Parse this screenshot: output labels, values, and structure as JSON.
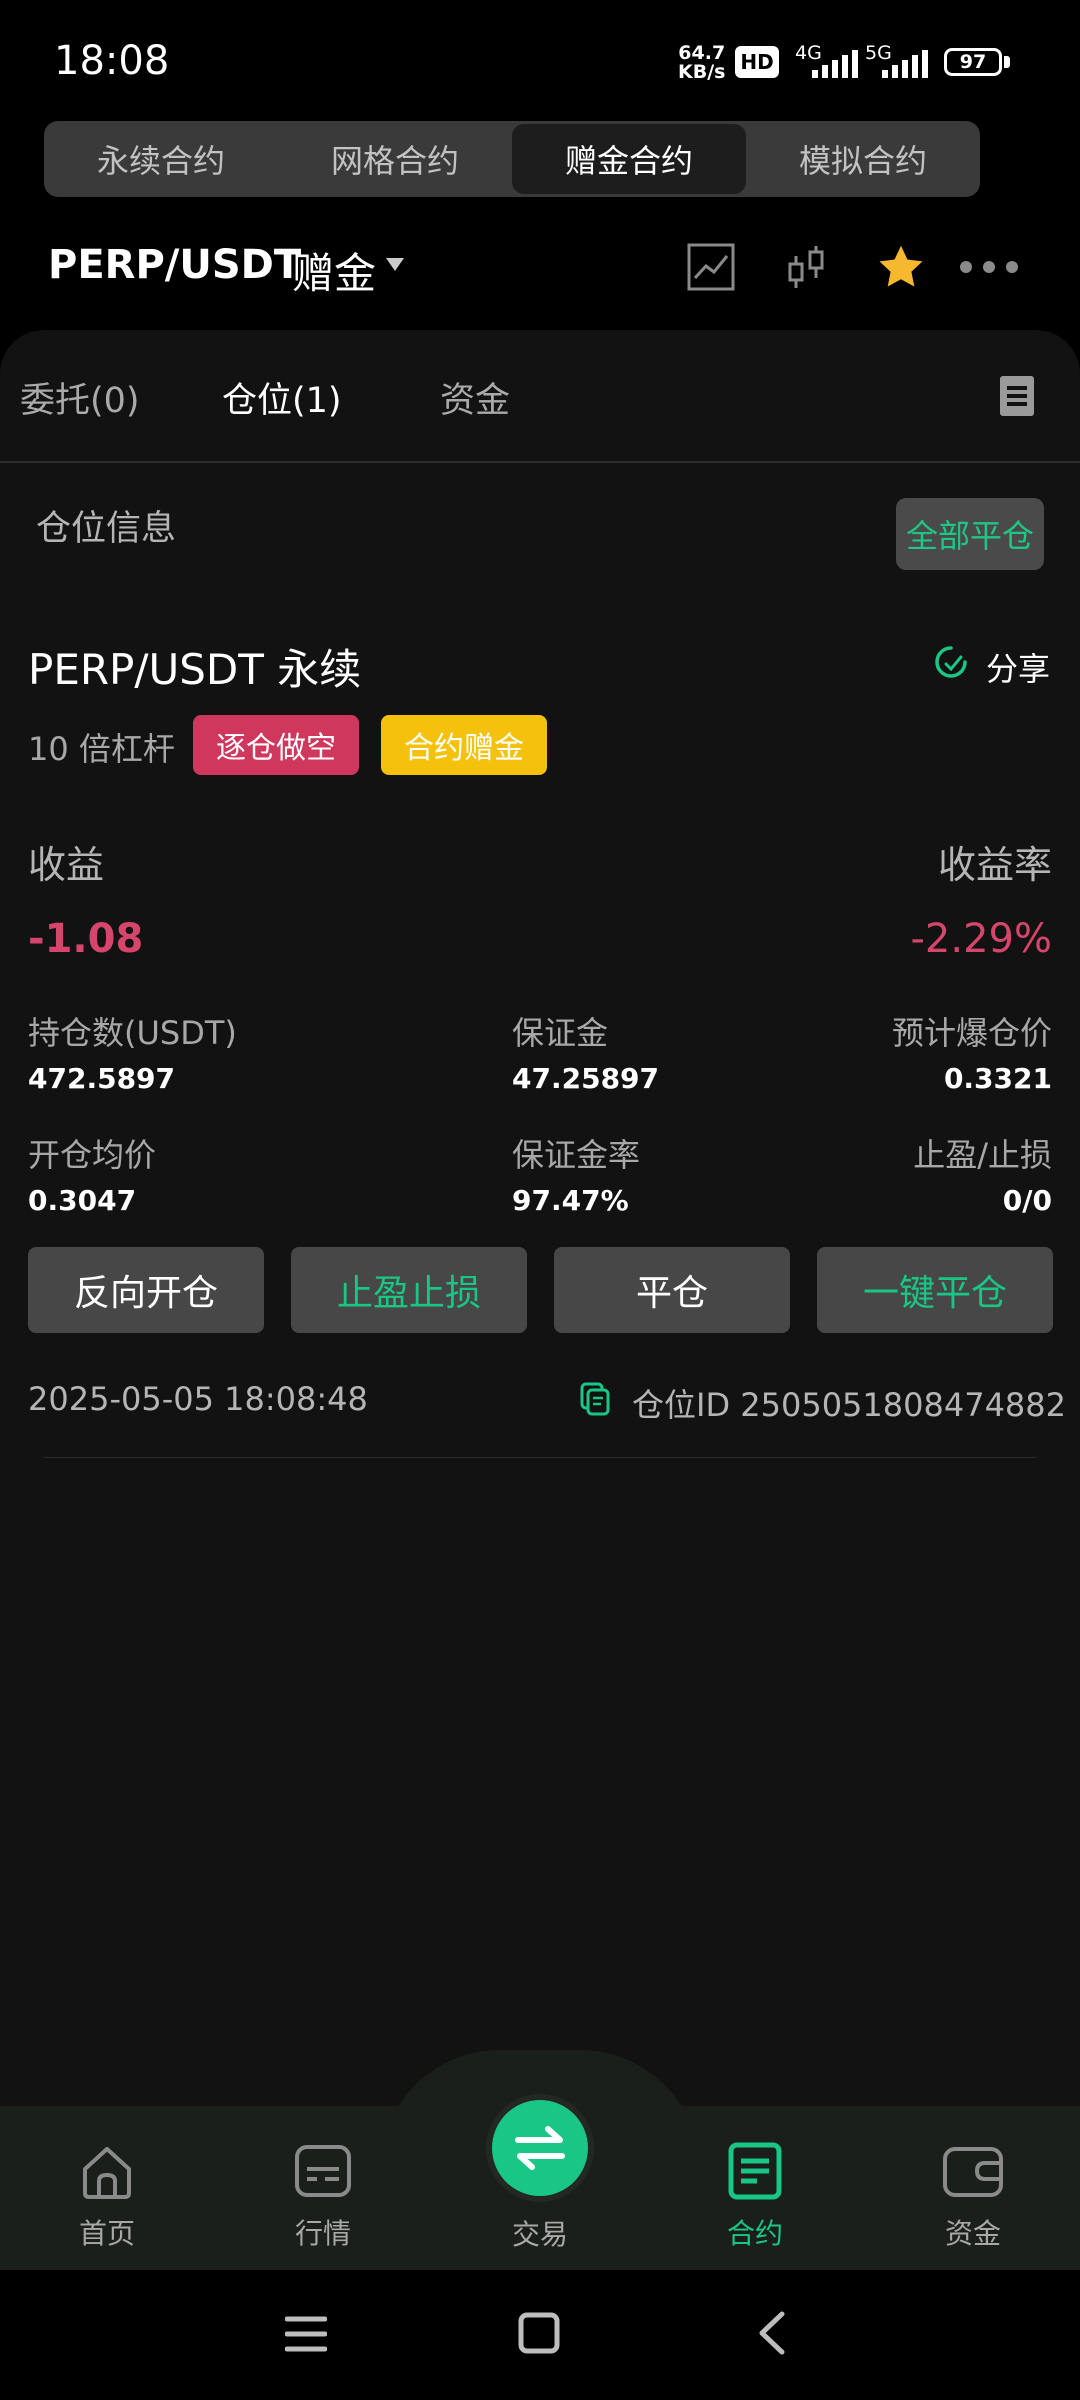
{
  "status": {
    "time": "18:08",
    "speed_value": "64.7",
    "speed_unit": "KB/s",
    "hd": "HD",
    "net_a": "4G",
    "net_b": "5G",
    "battery": "97"
  },
  "contract_tabs": [
    "永续合约",
    "网格合约",
    "赠金合约",
    "模拟合约"
  ],
  "active_contract_tab": 2,
  "header": {
    "pair": "PERP/USDT",
    "pair_type": "赠金"
  },
  "panel_tabs": [
    "委托(0)",
    "仓位(1)",
    "资金"
  ],
  "active_panel_tab": 1,
  "section": {
    "title": "仓位信息",
    "close_all": "全部平仓"
  },
  "position": {
    "symbol": "PERP/USDT 永续",
    "share": "分享",
    "leverage": "10 倍杠杆",
    "badge_mode": "逐仓做空",
    "badge_bonus": "合约赠金",
    "pnl_label": "收益",
    "pnl_rate_label": "收益率",
    "pnl": "-1.08",
    "pnl_rate": "-2.29%",
    "size_label": "持仓数(USDT)",
    "size": "472.5897",
    "margin_label": "保证金",
    "margin": "47.25897",
    "liq_label": "预计爆仓价",
    "liq": "0.3321",
    "entry_label": "开仓均价",
    "entry": "0.3047",
    "margin_rate_label": "保证金率",
    "margin_rate": "97.47%",
    "tpsl_label": "止盈/止损",
    "tpsl": "0/0",
    "btn_reverse": "反向开仓",
    "btn_tpsl": "止盈止损",
    "btn_close": "平仓",
    "btn_quick_close": "一键平仓",
    "datetime": "2025-05-05 18:08:48",
    "position_id": "仓位ID 2505051808474882"
  },
  "nav": [
    {
      "label": "首页",
      "icon": "home-icon"
    },
    {
      "label": "行情",
      "icon": "market-icon"
    },
    {
      "label": "交易",
      "icon": "swap-icon"
    },
    {
      "label": "合约",
      "icon": "contract-icon"
    },
    {
      "label": "资金",
      "icon": "wallet-icon"
    }
  ],
  "colors": {
    "accent": "#19c685",
    "loss": "#d6456b",
    "badge_red": "#d0375c",
    "badge_yellow": "#f4c20d"
  }
}
